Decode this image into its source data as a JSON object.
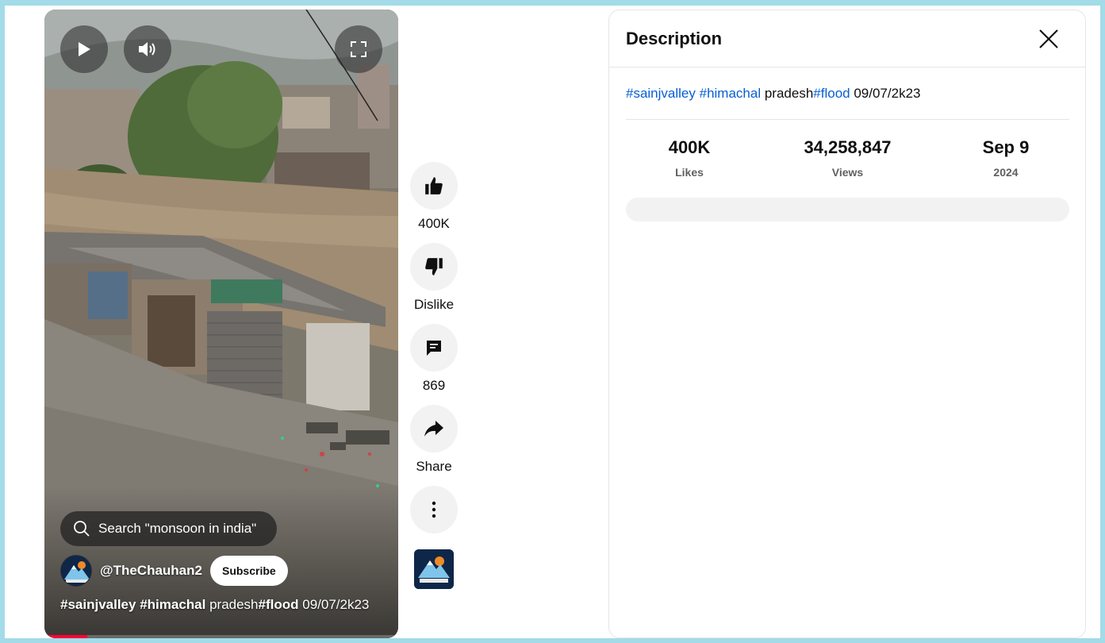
{
  "player": {
    "play_icon": "play-icon",
    "volume_icon": "volume-icon",
    "fullscreen_icon": "fullscreen-icon",
    "search_suggestion": "Search \"monsoon in india\"",
    "channel_handle": "@TheChauhan2",
    "subscribe_label": "Subscribe",
    "title": {
      "tag1": "#sainjvalley",
      "tag2": "#himachal",
      "text1": " pradesh",
      "tag3": "#flood",
      "text2": " 09/07/2k23"
    },
    "progress_fraction": 0.12
  },
  "actions": {
    "like_count": "400K",
    "dislike_label": "Dislike",
    "comment_count": "869",
    "share_label": "Share"
  },
  "description_panel": {
    "title": "Description",
    "text": {
      "tag1": "#sainjvalley",
      "tag2": "#himachal",
      "text1": " pradesh",
      "tag3": "#flood",
      "text2": " 09/07/2k23"
    },
    "stats": {
      "likes_value": "400K",
      "likes_label": "Likes",
      "views_value": "34,258,847",
      "views_label": "Views",
      "date_value": "Sep 9",
      "date_label": "2024"
    }
  },
  "colors": {
    "link": "#065fd4",
    "progress": "#ff0033",
    "frame": "#a3dbe8"
  }
}
